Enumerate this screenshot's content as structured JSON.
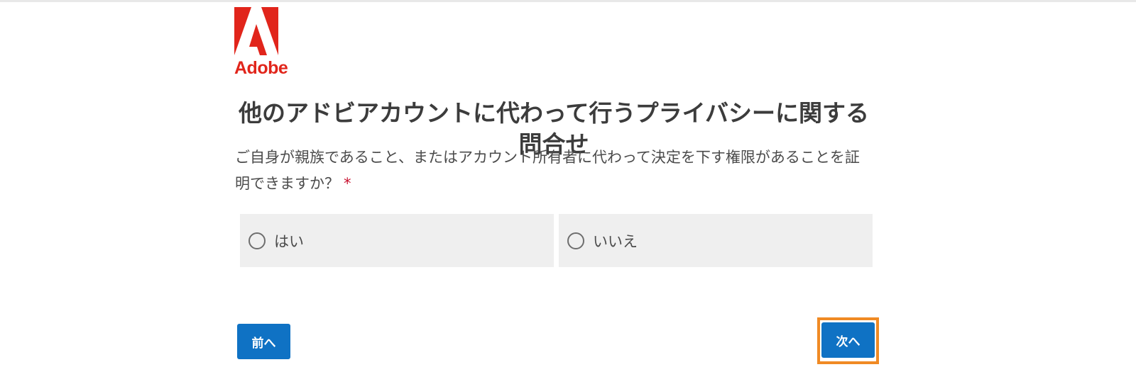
{
  "brand": {
    "logo_text": "Adobe",
    "logo_color": "#e1251b"
  },
  "page": {
    "title": "他のアドビアカウントに代わって行うプライバシーに関する問合せ",
    "question": "ご自身が親族であること、またはアカウント所有者に代わって決定を下す権限があることを証明できますか？",
    "required_mark": "*"
  },
  "options": [
    {
      "label": "はい",
      "selected": false
    },
    {
      "label": "いいえ",
      "selected": false
    }
  ],
  "buttons": {
    "prev_label": "前へ",
    "next_label": "次へ",
    "button_color": "#0f72c4",
    "highlight_color": "#f08a24"
  }
}
